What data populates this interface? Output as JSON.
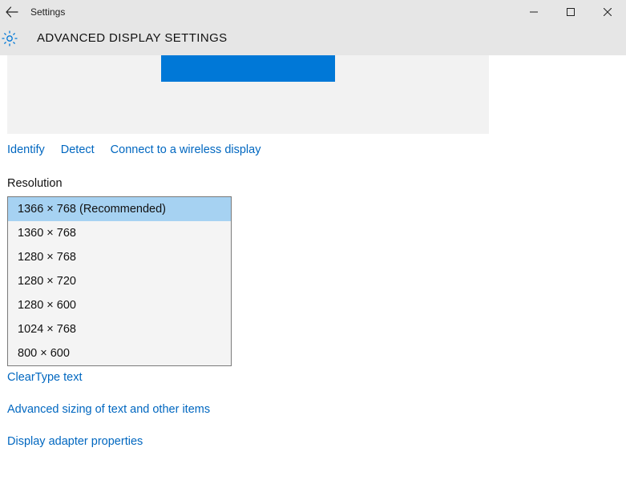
{
  "window": {
    "app_title": "Settings",
    "page_title": "ADVANCED DISPLAY SETTINGS"
  },
  "actions": {
    "identify": "Identify",
    "detect": "Detect",
    "wireless": "Connect to a wireless display"
  },
  "resolution": {
    "label": "Resolution",
    "options": [
      "1366 × 768 (Recommended)",
      "1360 × 768",
      "1280 × 768",
      "1280 × 720",
      "1280 × 600",
      "1024 × 768",
      "800 × 600"
    ],
    "selected_index": 0
  },
  "links": {
    "cleartype": "ClearType text",
    "advanced_sizing": "Advanced sizing of text and other items",
    "adapter": "Display adapter properties"
  }
}
